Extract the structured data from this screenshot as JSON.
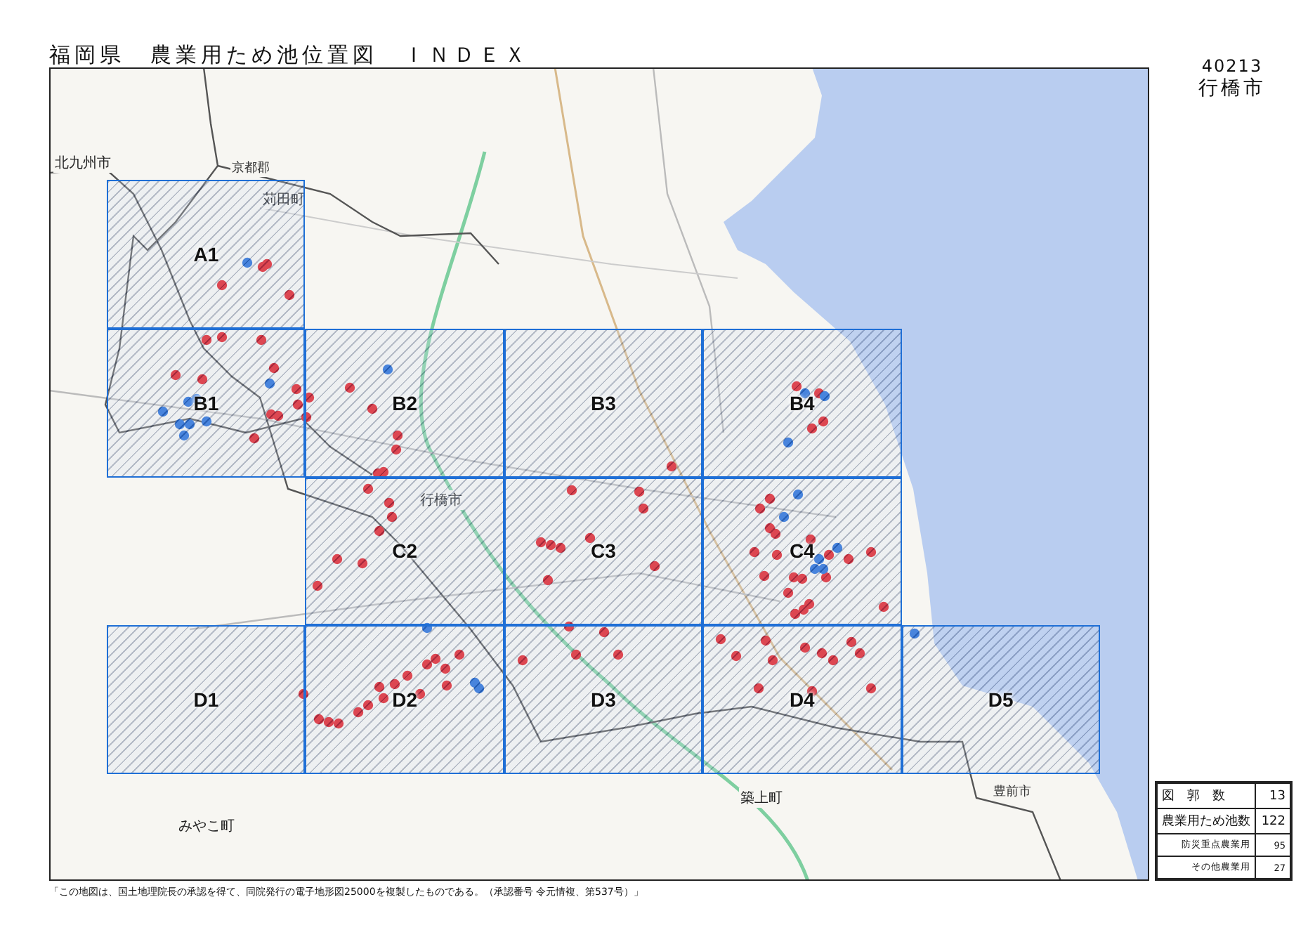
{
  "title": "福岡県　農業用ため池位置図　ＩＮＤＥＸ",
  "city_code": "40213",
  "city_name": "行橋市",
  "map": {
    "place_names": [
      {
        "text": "北九州市",
        "kind": "major"
      },
      {
        "text": "京都郡",
        "kind": "minor"
      },
      {
        "text": "苅田町",
        "kind": "major"
      },
      {
        "text": "行橋市",
        "kind": "major"
      },
      {
        "text": "みやこ町",
        "kind": "major"
      },
      {
        "text": "築上町",
        "kind": "major"
      },
      {
        "text": "豊前市",
        "kind": "minor"
      }
    ],
    "grid_rows": [
      {
        "cells": [
          "A1",
          null,
          null,
          null,
          null
        ]
      },
      {
        "cells": [
          "B1",
          "B2",
          "B3",
          "B4",
          null
        ]
      },
      {
        "cells": [
          null,
          "C2",
          "C3",
          "C4",
          null
        ]
      },
      {
        "cells": [
          "D1",
          "D2",
          "D3",
          "D4",
          "D5"
        ]
      }
    ]
  },
  "summary": [
    {
      "label": "図　郭　数",
      "value": "13",
      "kind": "major"
    },
    {
      "label": "農業用ため池数",
      "value": "122",
      "kind": "major"
    },
    {
      "label": "防災重点農業用",
      "value": "95",
      "kind": "minor"
    },
    {
      "label": "その他農業用",
      "value": "27",
      "kind": "minor"
    }
  ],
  "footer": "「この地図は、国土地理院長の承認を得て、同院発行の電子地形図25000を複製したものである。（承認番号 令元情複、第537号）」"
}
